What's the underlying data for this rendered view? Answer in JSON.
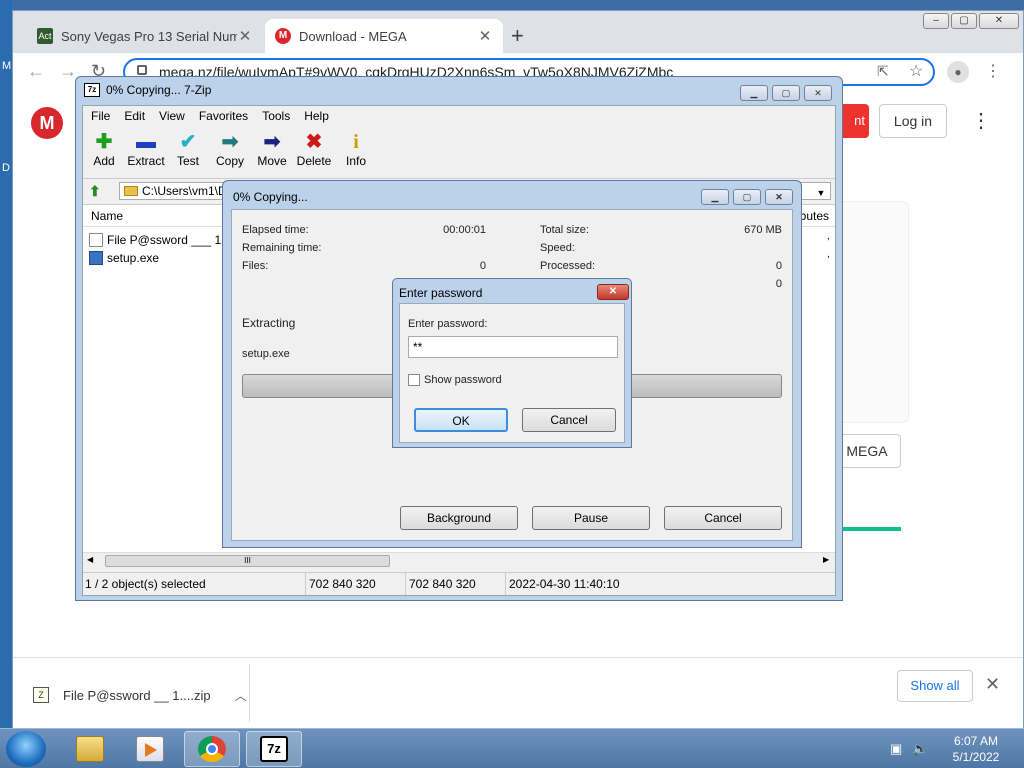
{
  "desktop": {
    "icon_letters": [
      "M",
      "D"
    ]
  },
  "browser": {
    "tabs": [
      {
        "title": "Sony Vegas Pro 13 Serial Numbe",
        "favicon_text": "Act",
        "active": false
      },
      {
        "title": "Download - MEGA",
        "favicon_text": "M",
        "active": true
      }
    ],
    "new_tab": "+",
    "window_buttons": [
      "–",
      "▢",
      "✕"
    ],
    "url": "mega.nz/file/wuIymApT#9vWV0_cgkDrgHUzD2Xnn6sSm_vTw5oX8NJMV6ZiZMbc",
    "page": {
      "logo": "M",
      "red_button_text": "nt",
      "login_label": "Log in",
      "mega_button_label": "MEGA"
    },
    "download_bar": {
      "file_name": "File P@ssword __ 1....zip",
      "show_all_label": "Show all"
    }
  },
  "sevenzip": {
    "title": "0% Copying... 7-Zip",
    "icon_text": "7z",
    "menu": [
      "File",
      "Edit",
      "View",
      "Favorites",
      "Tools",
      "Help"
    ],
    "toolbar": [
      {
        "label": "Add",
        "icon": "plus-icon",
        "glyph": "✚",
        "color": "#1ea01e"
      },
      {
        "label": "Extract",
        "icon": "minus-icon",
        "glyph": "▬",
        "color": "#1f3fbf"
      },
      {
        "label": "Test",
        "icon": "check-icon",
        "glyph": "✔",
        "color": "#2bb0c8"
      },
      {
        "label": "Copy",
        "icon": "copy-arrow-icon",
        "glyph": "➡",
        "color": "#1f7a7a"
      },
      {
        "label": "Move",
        "icon": "move-arrow-icon",
        "glyph": "➡",
        "color": "#1a237e"
      },
      {
        "label": "Delete",
        "icon": "delete-x-icon",
        "glyph": "✖",
        "color": "#d01818"
      },
      {
        "label": "Info",
        "icon": "info-icon",
        "glyph": "i",
        "color": "#c9a000"
      }
    ],
    "path": "C:\\Users\\vm1\\D",
    "columns": {
      "name": "Name",
      "attributes": "ributes"
    },
    "files": [
      {
        "name": "File P@ssword ___ 12",
        "type": "file"
      },
      {
        "name": "setup.exe",
        "type": "exe"
      }
    ],
    "scroll_grip": "III",
    "status": {
      "selected": "1 / 2 object(s) selected",
      "size": "702 840 320",
      "packed": "702 840 320",
      "modified": "2022-04-30 11:40:10"
    }
  },
  "copying_dialog": {
    "title": "0% Copying...",
    "elapsed_label": "Elapsed time:",
    "elapsed_value": "00:00:01",
    "remaining_label": "Remaining time:",
    "files_label": "Files:",
    "files_value": "0",
    "total_size_label": "Total size:",
    "total_size_value": "670 MB",
    "speed_label": "Speed:",
    "processed_label": "Processed:",
    "processed_value": "0",
    "extra_value": "0",
    "extracting_label": "Extracting",
    "current_file": "setup.exe",
    "progress": 0,
    "buttons": {
      "background": "Background",
      "pause": "Pause",
      "cancel": "Cancel"
    }
  },
  "password_dialog": {
    "title": "Enter password",
    "prompt": "Enter password:",
    "value": "**",
    "show_password_label": "Show password",
    "show_password_checked": false,
    "ok_label": "OK",
    "cancel_label": "Cancel"
  },
  "taskbar": {
    "time": "6:07 AM",
    "date": "5/1/2022",
    "apps": [
      "explorer-icon",
      "media-player-icon",
      "chrome-icon",
      "7zip-icon"
    ],
    "sevenzip_text": "7z"
  }
}
